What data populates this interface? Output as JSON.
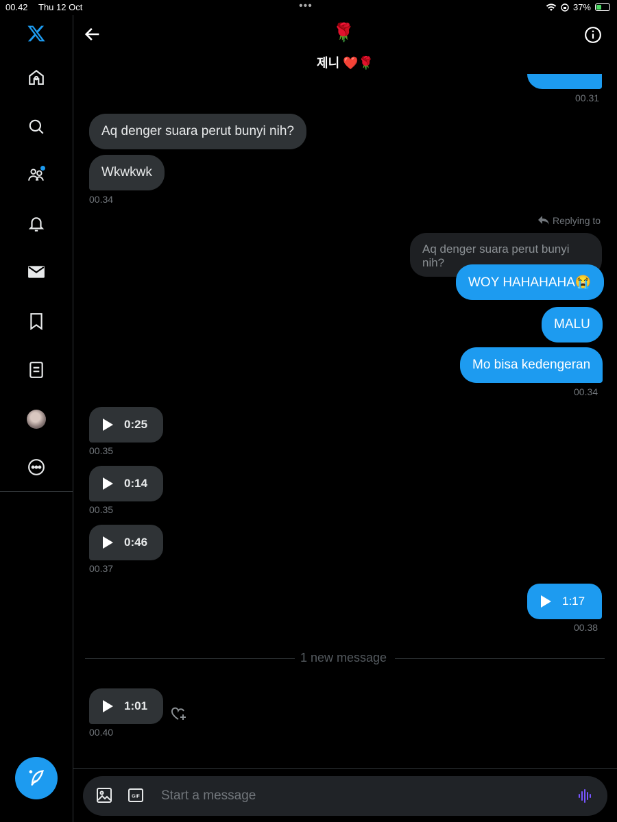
{
  "status_bar": {
    "time": "00.42",
    "date": "Thu 12 Oct",
    "dots": "•••",
    "battery": "37%"
  },
  "header": {
    "avatar_emoji": "🌹",
    "title": "제니 ❤️🌹"
  },
  "messages": {
    "top_out_ts": "00.31",
    "in_1": "Aq denger suara perut bunyi nih?",
    "in_2": "Wkwkwk",
    "in_ts": "00.34",
    "reply_label": "Replying to",
    "reply_quote": "Aq denger suara perut bunyi nih?",
    "out_1": "WOY HAHAHAHA😭",
    "out_2": "MALU",
    "out_3": "Mo bisa kedengeran",
    "out_ts": "00.34",
    "voice_1": {
      "duration": "0:25",
      "time": "00.35"
    },
    "voice_2": {
      "duration": "0:14",
      "time": "00.35"
    },
    "voice_3": {
      "duration": "0:46",
      "time": "00.37"
    },
    "voice_out": {
      "duration": "1:17",
      "time": "00.38"
    },
    "new_message_divider": "1 new message",
    "voice_4": {
      "duration": "1:01",
      "time": "00.40"
    }
  },
  "composer": {
    "placeholder": "Start a message"
  },
  "colors": {
    "accent": "#1d9bf0",
    "incoming_bubble": "#2f3336",
    "background": "#000000"
  },
  "icons": {
    "sidebar": [
      "x-logo-icon",
      "home-icon",
      "search-icon",
      "communities-icon",
      "notifications-icon",
      "messages-icon",
      "bookmarks-icon",
      "lists-icon",
      "profile-avatar",
      "more-icon"
    ],
    "compose": "compose-post-icon",
    "header": [
      "back-arrow-icon",
      "info-icon"
    ],
    "composer": [
      "image-icon",
      "gif-icon",
      "voice-icon"
    ]
  }
}
